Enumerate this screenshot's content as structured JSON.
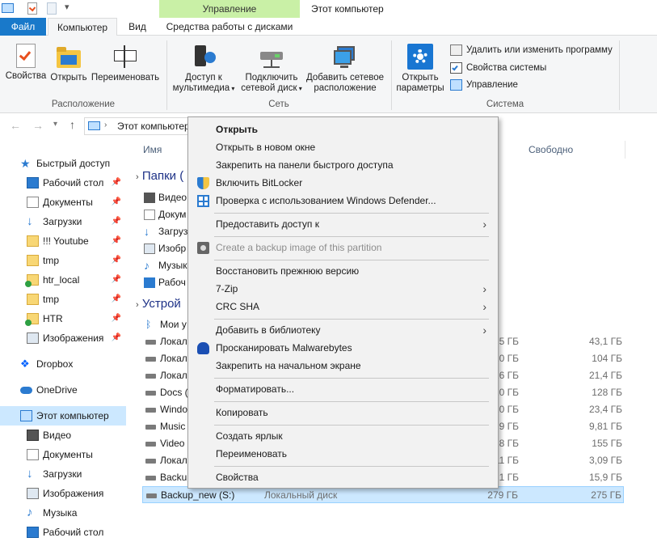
{
  "title_bar": {
    "manage_label": "Управление",
    "window_title": "Этот компьютер"
  },
  "tabs": {
    "file": "Файл",
    "computer": "Компьютер",
    "view": "Вид",
    "disk_tools": "Средства работы с дисками"
  },
  "ribbon": {
    "location": {
      "label": "Расположение",
      "properties": "Свойства",
      "open": "Открыть",
      "rename": "Переименовать"
    },
    "network": {
      "label": "Сеть",
      "media_access_1": "Доступ к",
      "media_access_2": "мультимедиа",
      "map_drive_1": "Подключить",
      "map_drive_2": "сетевой диск",
      "add_location_1": "Добавить сетевое",
      "add_location_2": "расположение"
    },
    "system": {
      "label": "Система",
      "open_settings_1": "Открыть",
      "open_settings_2": "параметры",
      "uninstall": "Удалить или изменить программу",
      "system_props": "Свойства системы",
      "manage": "Управление"
    }
  },
  "address": {
    "path": "Этот компьютер"
  },
  "nav": {
    "quick_access": "Быстрый доступ",
    "items": [
      "Рабочий стол",
      "Документы",
      "Загрузки",
      "!!! Youtube",
      "tmp",
      "htr_local",
      "tmp",
      "HTR",
      "Изображения"
    ],
    "dropbox": "Dropbox",
    "onedrive": "OneDrive",
    "this_pc": "Этот компьютер",
    "pc_items": [
      "Видео",
      "Документы",
      "Загрузки",
      "Изображения",
      "Музыка",
      "Рабочий стол"
    ]
  },
  "main": {
    "col_name": "Имя",
    "col_free": "Свободно",
    "folders_section": "Папки (",
    "folders": [
      "Видео",
      "Докум",
      "Загрузк",
      "Изобр",
      "Музык",
      "Рабоч"
    ],
    "devices_section": "Устрой",
    "devices": [
      {
        "name": "Мои у",
        "total": "",
        "free": ""
      },
      {
        "name": "Локал",
        "total": "15 ГБ",
        "free": "43,1 ГБ"
      },
      {
        "name": "Локал",
        "total": "10 ГБ",
        "free": "104 ГБ"
      },
      {
        "name": "Локал",
        "total": "16 ГБ",
        "free": "21,4 ГБ"
      },
      {
        "name": "Docs (",
        "total": "10 ГБ",
        "free": "128 ГБ"
      },
      {
        "name": "Windo",
        "total": "10 ГБ",
        "free": "23,4 ГБ"
      },
      {
        "name": "Music",
        "total": "19 ГБ",
        "free": "9,81 ГБ"
      },
      {
        "name": "Video",
        "total": "18 ГБ",
        "free": "155 ГБ"
      },
      {
        "name": "Локал",
        "total": "11 ГБ",
        "free": "3,09 ГБ"
      },
      {
        "name": "Backup",
        "total": "21 ГБ",
        "free": "15,9 ГБ"
      }
    ],
    "selected_drive": {
      "name": "Backup_new (S:)",
      "type": "Локальный диск",
      "total": "279 ГБ",
      "free": "275 ГБ"
    }
  },
  "context_menu": {
    "open": "Открыть",
    "open_new_window": "Открыть в новом окне",
    "pin_quick": "Закрепить на панели быстрого доступа",
    "bitlocker": "Включить BitLocker",
    "defender": "Проверка с использованием Windows Defender...",
    "share": "Предоставить доступ к",
    "backup_image": "Create a backup image of this partition",
    "restore": "Восстановить прежнюю версию",
    "zip": "7-Zip",
    "crc": "CRC SHA",
    "library": "Добавить в библиотеку",
    "malwarebytes": "Просканировать Malwarebytes",
    "pin_start": "Закрепить на начальном экране",
    "format": "Форматировать...",
    "copy": "Копировать",
    "shortcut": "Создать ярлык",
    "rename": "Переименовать",
    "properties": "Свойства"
  },
  "colors": {
    "accent": "#1979ca",
    "manage": "#c9f0a6",
    "selection": "#cce8ff"
  }
}
